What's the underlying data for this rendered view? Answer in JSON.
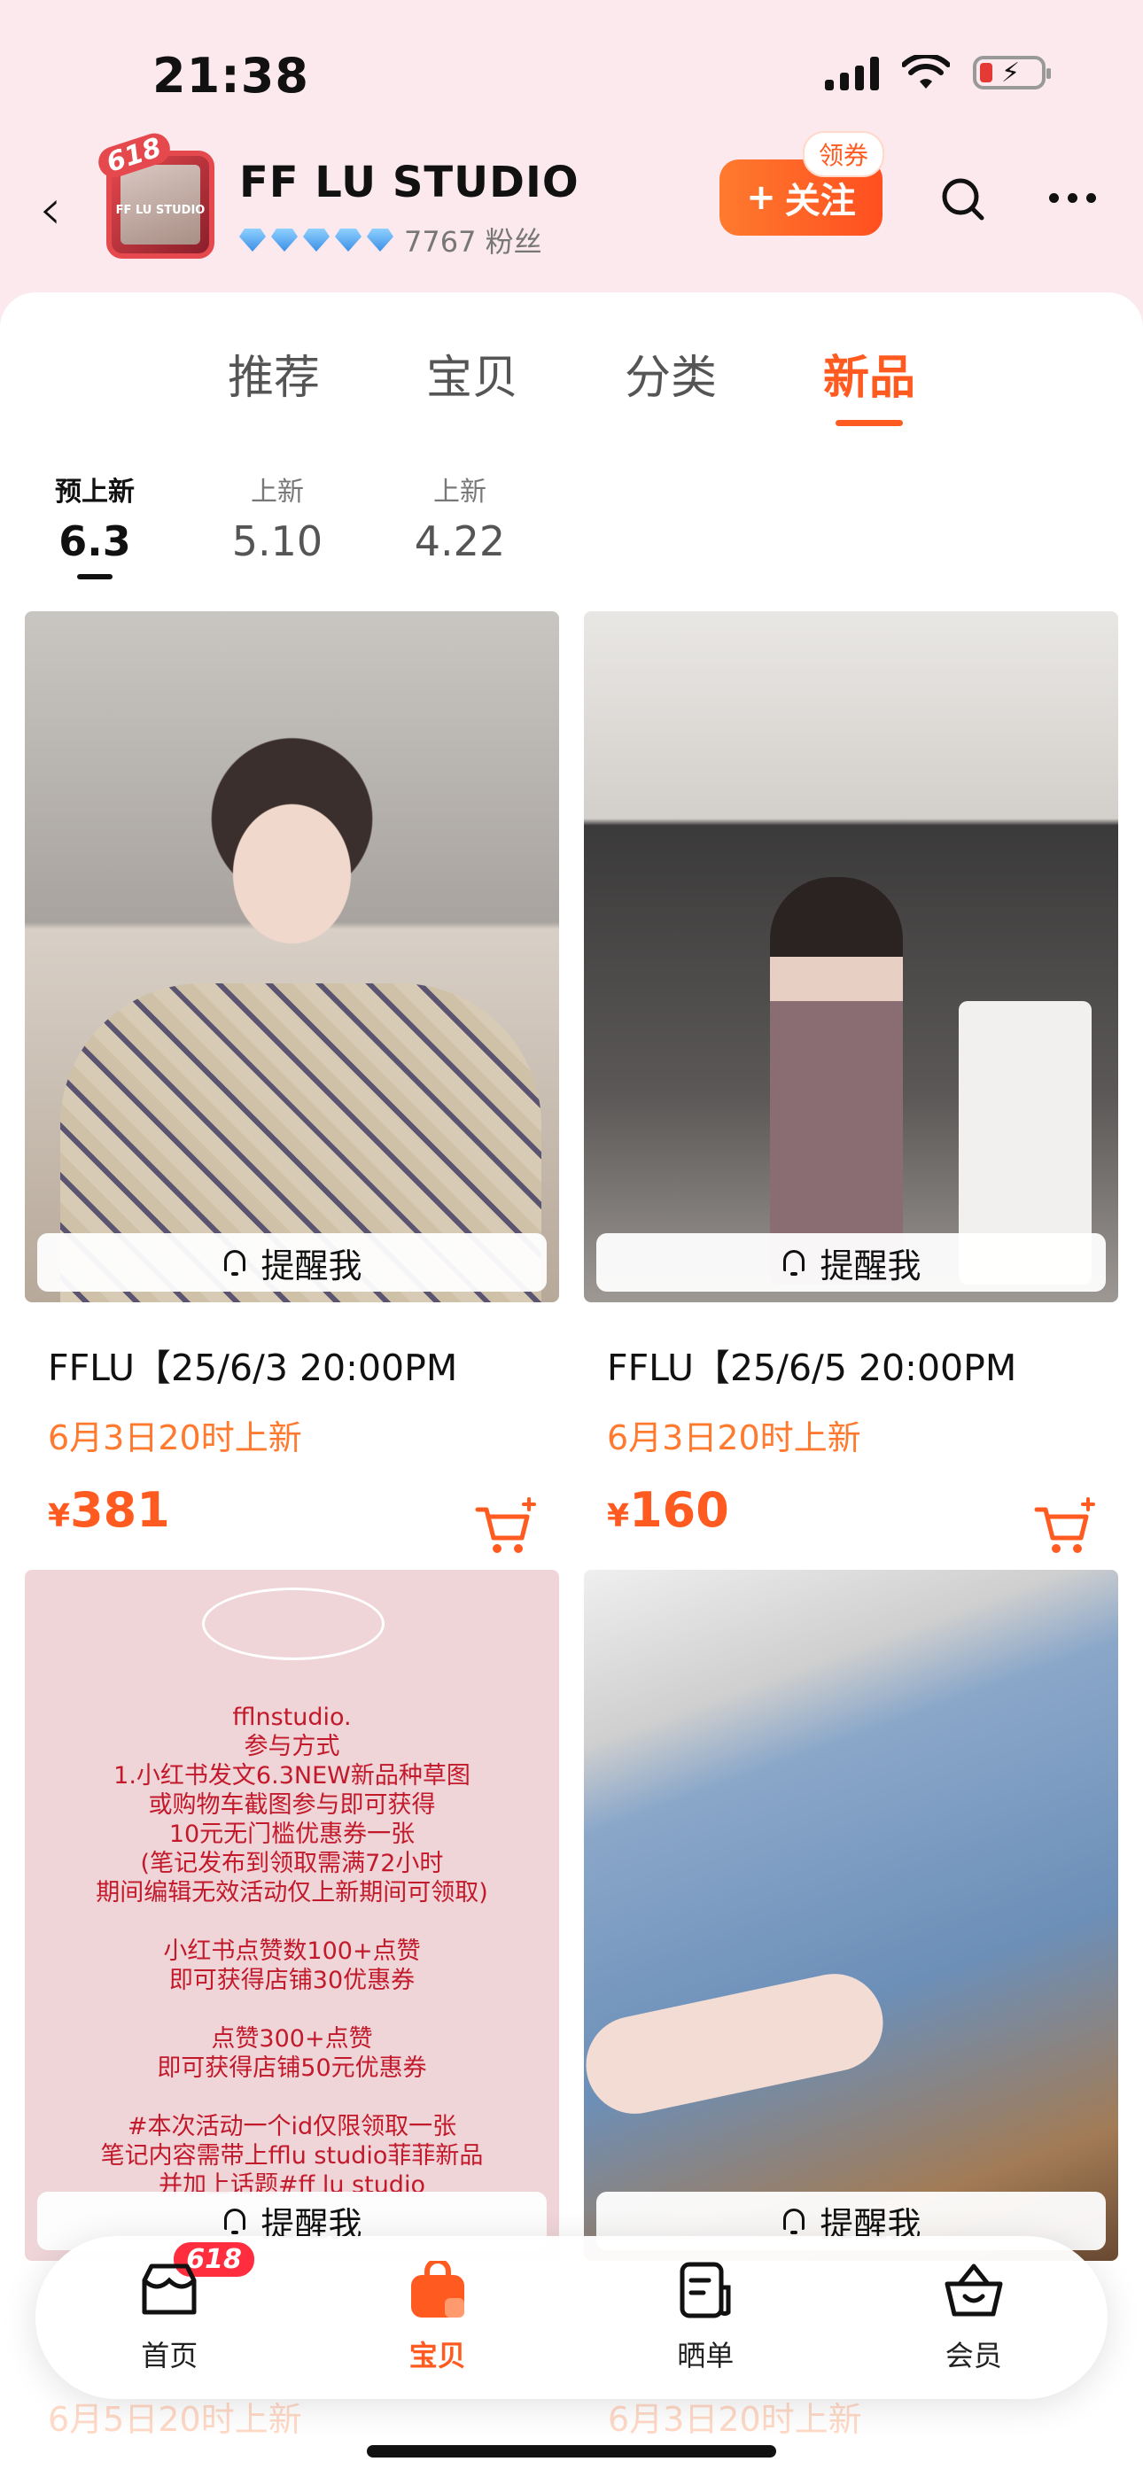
{
  "status": {
    "time": "21:38"
  },
  "shop": {
    "logo_text": "FF LU STUDIO",
    "logo_badge": "618",
    "name": "FF LU STUDIO",
    "followers": "7767 粉丝",
    "follow_label": "关注",
    "coupon_label": "领券"
  },
  "tabs": [
    "推荐",
    "宝贝",
    "分类",
    "新品"
  ],
  "active_tab": "新品",
  "date_tabs": [
    {
      "kind": "预上新",
      "date": "6.3",
      "active": true
    },
    {
      "kind": "上新",
      "date": "5.10",
      "active": false
    },
    {
      "kind": "上新",
      "date": "4.22",
      "active": false
    }
  ],
  "products": [
    {
      "title": "FFLU【25/6/3 20:00PM",
      "subtitle": "6月3日20时上新",
      "price_symbol": "¥",
      "price": "381",
      "remind_label": "提醒我"
    },
    {
      "title": "FFLU【25/6/5 20:00PM",
      "subtitle": "6月3日20时上新",
      "price_symbol": "¥",
      "price": "160",
      "remind_label": "提醒我"
    },
    {
      "title": "",
      "subtitle": "6月5日20时上新",
      "price_symbol": "",
      "price": "",
      "remind_label": "提醒我",
      "poster_text": "fflnstudio.\n参与方式\n1.小红书发文6.3NEW新品种草图\n或购物车截图参与即可获得\n10元无门槛优惠券一张\n(笔记发布到领取需满72小时\n期间编辑无效活动仅上新期间可领取)\n\n小红书点赞数100+点赞\n即可获得店铺30优惠券\n\n点赞300+点赞\n即可获得店铺50元优惠券\n\n#本次活动一个id仅限领取一张\n笔记内容需带上fflu studio菲菲新品\n并加上话题#ff lu studio"
    },
    {
      "title": "",
      "subtitle": "6月3日20时上新",
      "price_symbol": "",
      "price": "",
      "remind_label": "提醒我"
    }
  ],
  "tabbar": {
    "items": [
      {
        "label": "首页",
        "badge": "618"
      },
      {
        "label": "宝贝"
      },
      {
        "label": "晒单"
      },
      {
        "label": "会员"
      }
    ],
    "active": "宝贝"
  },
  "colors": {
    "accent": "#ff5a1f",
    "subtitle": "#ff7a2e",
    "header_bg": "#fbe9ee"
  }
}
